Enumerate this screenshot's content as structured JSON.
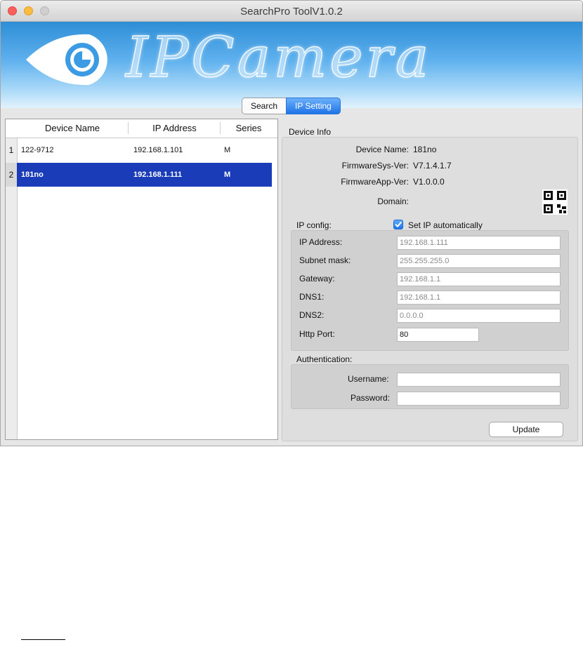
{
  "window": {
    "title": "SearchPro ToolV1.0.2"
  },
  "banner": {
    "text": "IPCamera"
  },
  "tabs": [
    {
      "label": "Search",
      "active": false
    },
    {
      "label": "IP Setting",
      "active": true
    }
  ],
  "device_table": {
    "columns": [
      "Device Name",
      "IP Address",
      "Series"
    ],
    "rows": [
      {
        "num": "1",
        "name": "122-9712",
        "ip": "192.168.1.101",
        "series": "M",
        "selected": false
      },
      {
        "num": "2",
        "name": "181no",
        "ip": "192.168.1.111",
        "series": "M",
        "selected": true
      }
    ]
  },
  "device_info": {
    "section_label": "Device Info",
    "device_name_label": "Device Name:",
    "device_name": "181no",
    "firmware_sys_label": "FirmwareSys-Ver:",
    "firmware_sys": "V7.1.4.1.7",
    "firmware_app_label": "FirmwareApp-Ver:",
    "firmware_app": "V1.0.0.0",
    "domain_label": "Domain:"
  },
  "ip_config": {
    "section_label": "IP config:",
    "auto_label": "Set IP automatically",
    "auto_checked": true,
    "ip_label": "IP Address:",
    "ip_value": "192.168.1.111",
    "subnet_label": "Subnet mask:",
    "subnet_value": "255.255.255.0",
    "gateway_label": "Gateway:",
    "gateway_value": "192.168.1.1",
    "dns1_label": "DNS1:",
    "dns1_value": "192.168.1.1",
    "dns2_label": "DNS2:",
    "dns2_value": "0.0.0.0",
    "http_label": "Http Port:",
    "http_value": "80"
  },
  "auth": {
    "section_label": "Authentication:",
    "username_label": "Username:",
    "username_value": "",
    "password_label": "Password:",
    "password_value": ""
  },
  "actions": {
    "update_label": "Update"
  },
  "colors": {
    "accent": "#1f73e8",
    "selection": "#1a3cb8",
    "banner": "#3d9be3"
  }
}
